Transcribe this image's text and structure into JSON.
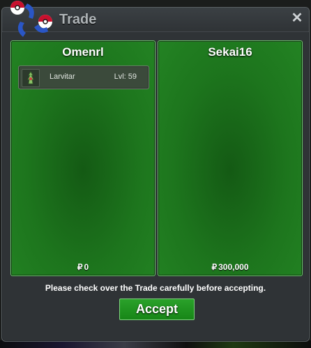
{
  "window": {
    "title": "Trade",
    "close_symbol": "✕"
  },
  "left_panel": {
    "player_name": "Omenrl",
    "items": [
      {
        "name": "Larvitar",
        "level_text": "Lvl: 59"
      }
    ],
    "money_symbol": "₽",
    "money_amount": "0"
  },
  "right_panel": {
    "player_name": "Sekai16",
    "money_symbol": "₽",
    "money_amount": "300,000"
  },
  "notice_text": "Please check over the Trade carefully before accepting.",
  "accept_label": "Accept",
  "colors": {
    "panel_green": "#1d751d",
    "button_green": "#2aa12a",
    "window_bg": "#2f3336"
  }
}
